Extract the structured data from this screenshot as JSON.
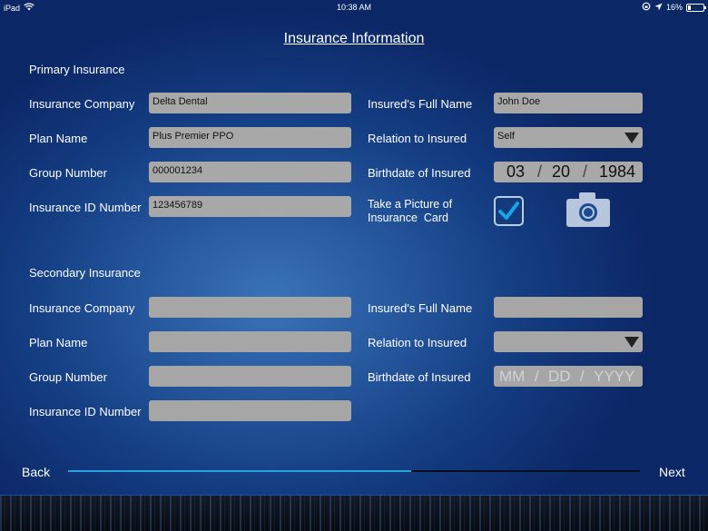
{
  "status_bar": {
    "device": "iPad",
    "time": "10:38 AM",
    "battery_text": "16%",
    "battery_level": 0.16,
    "icons": [
      "wifi-icon",
      "rotation-lock-icon",
      "location-arrow-icon",
      "battery-icon"
    ]
  },
  "page_title": "Insurance Information",
  "primary": {
    "section_title": "Primary Insurance",
    "insurance_company_label": "Insurance Company",
    "insurance_company_value": "Delta Dental",
    "plan_name_label": "Plan Name",
    "plan_name_value": "Plus Premier PPO",
    "group_number_label": "Group Number",
    "group_number_value": "000001234",
    "insurance_id_label": "Insurance ID Number",
    "insurance_id_value": "123456789",
    "insured_name_label": "Insured's Full Name",
    "insured_name_value": "John Doe",
    "relation_label": "Relation to Insured",
    "relation_value": "Self",
    "birthdate_label": "Birthdate of Insured",
    "birth_month": "03",
    "birth_day": "20",
    "birth_year": "1984",
    "date_separator": "/",
    "picture_label_line1": "Take a Picture of",
    "picture_label_line2": "Insurance  Card",
    "picture_checked": true
  },
  "secondary": {
    "section_title": "Secondary Insurance",
    "insurance_company_label": "Insurance Company",
    "insurance_company_value": "",
    "plan_name_label": "Plan Name",
    "plan_name_value": "",
    "group_number_label": "Group Number",
    "group_number_value": "",
    "insurance_id_label": "Insurance ID Number",
    "insurance_id_value": "",
    "insured_name_label": "Insured's Full Name",
    "insured_name_value": "",
    "relation_label": "Relation to Insured",
    "relation_value": "",
    "birthdate_label": "Birthdate of Insured",
    "birth_month_placeholder": "MM",
    "birth_day_placeholder": "DD",
    "birth_year_placeholder": "YYYY",
    "date_separator": "/"
  },
  "navigation": {
    "back_label": "Back",
    "next_label": "Next",
    "progress_fraction": 0.6
  },
  "colors": {
    "accent_progress": "#27a3e0",
    "checkbox_check": "#1aa3e8",
    "field_bg": "#a8a8a8",
    "background_dark": "#0c2766"
  }
}
